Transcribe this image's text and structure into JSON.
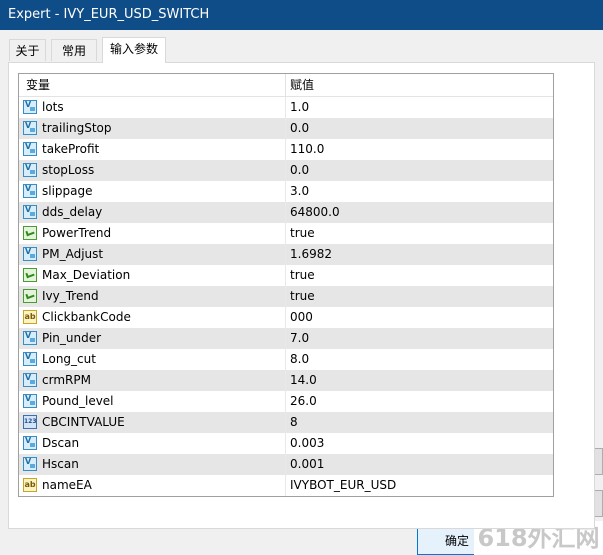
{
  "window": {
    "title": "Expert - IVY_EUR_USD_SWITCH"
  },
  "tabs": [
    {
      "label": "关于"
    },
    {
      "label": "常用"
    },
    {
      "label": "输入参数",
      "active": true
    }
  ],
  "grid": {
    "headers": {
      "variable": "变量",
      "value": "赋值"
    },
    "rows": [
      {
        "icon": "variable-icon",
        "name": "lots",
        "value": "1.0"
      },
      {
        "icon": "variable-icon",
        "name": "trailingStop",
        "value": "0.0"
      },
      {
        "icon": "variable-icon",
        "name": "takeProfit",
        "value": "110.0"
      },
      {
        "icon": "variable-icon",
        "name": "stopLoss",
        "value": "0.0"
      },
      {
        "icon": "variable-icon",
        "name": "slippage",
        "value": "3.0"
      },
      {
        "icon": "variable-icon",
        "name": "dds_delay",
        "value": "64800.0"
      },
      {
        "icon": "boolean-icon",
        "name": "PowerTrend",
        "value": "true"
      },
      {
        "icon": "variable-icon",
        "name": "PM_Adjust",
        "value": "1.6982"
      },
      {
        "icon": "boolean-icon",
        "name": "Max_Deviation",
        "value": "true"
      },
      {
        "icon": "boolean-icon",
        "name": "Ivy_Trend",
        "value": "true"
      },
      {
        "icon": "string-icon",
        "name": "ClickbankCode",
        "value": "000"
      },
      {
        "icon": "variable-icon",
        "name": "Pin_under",
        "value": "7.0"
      },
      {
        "icon": "variable-icon",
        "name": "Long_cut",
        "value": "8.0"
      },
      {
        "icon": "variable-icon",
        "name": "crmRPM",
        "value": "14.0"
      },
      {
        "icon": "variable-icon",
        "name": "Pound_level",
        "value": "26.0"
      },
      {
        "icon": "integer-icon",
        "name": "CBCINTVALUE",
        "value": "8"
      },
      {
        "icon": "variable-icon",
        "name": "Dscan",
        "value": "0.003"
      },
      {
        "icon": "variable-icon",
        "name": "Hscan",
        "value": "0.001"
      },
      {
        "icon": "string-icon",
        "name": "nameEA",
        "value": "IVYBOT_EUR_USD"
      }
    ]
  },
  "icon_text": {
    "string": "ab",
    "integer": "123"
  },
  "buttons": {
    "ok": "确定"
  },
  "watermark": "618外汇网",
  "colors": {
    "titlebar": "#0f4d88",
    "row_alt": "#e6e6e6"
  }
}
